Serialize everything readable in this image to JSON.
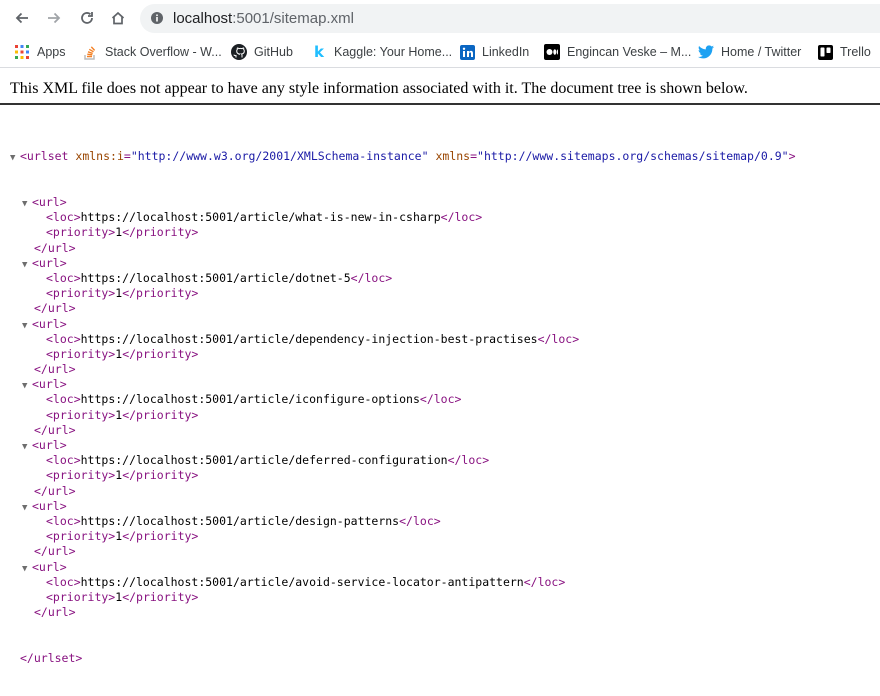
{
  "browser": {
    "url_host": "localhost",
    "url_rest": ":5001/sitemap.xml"
  },
  "bookmarks": [
    {
      "label": "Apps"
    },
    {
      "label": "Stack Overflow - W..."
    },
    {
      "label": "GitHub"
    },
    {
      "label": "Kaggle: Your Home..."
    },
    {
      "label": "LinkedIn"
    },
    {
      "label": "Engincan Veske – M..."
    },
    {
      "label": "Home / Twitter"
    },
    {
      "label": "Trello"
    }
  ],
  "page": {
    "notice": "This XML file does not appear to have any style information associated with it. The document tree is shown below.",
    "urlset": {
      "open_tag": "<urlset",
      "attr1_name": "xmlns:i",
      "attr1_value": "\"http://www.w3.org/2001/XMLSchema-instance\"",
      "attr2_name": "xmlns",
      "attr2_value": "\"http://www.sitemaps.org/schemas/sitemap/0.9\"",
      "close_tag": "</urlset>"
    },
    "urls": [
      {
        "loc": "https://localhost:5001/article/what-is-new-in-csharp",
        "priority": "1"
      },
      {
        "loc": "https://localhost:5001/article/dotnet-5",
        "priority": "1"
      },
      {
        "loc": "https://localhost:5001/article/dependency-injection-best-practises",
        "priority": "1"
      },
      {
        "loc": "https://localhost:5001/article/iconfigure-options",
        "priority": "1"
      },
      {
        "loc": "https://localhost:5001/article/deferred-configuration",
        "priority": "1"
      },
      {
        "loc": "https://localhost:5001/article/design-patterns",
        "priority": "1"
      },
      {
        "loc": "https://localhost:5001/article/avoid-service-locator-antipattern",
        "priority": "1"
      }
    ]
  }
}
